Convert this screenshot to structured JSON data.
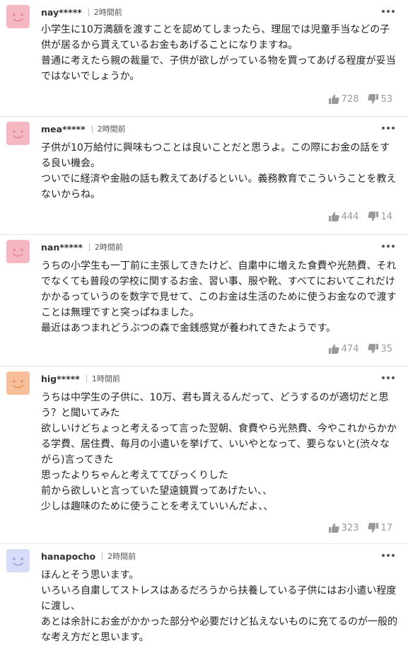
{
  "comments": [
    {
      "username": "nay*****",
      "time": "2時間前",
      "avatar_color": "#f5b7c2",
      "avatar_face_color": "#e48a9a",
      "text": "小学生に10万満額を渡すことを認めてしまったら、理屈では児童手当などの子供が居るから貰えているお金もあげることになりますね。\n普通に考えたら親の裁量で、子供が欲しがっている物を買ってあげる程度が妥当ではないでしょうか。",
      "likes": "728",
      "dislikes": "53"
    },
    {
      "username": "mea*****",
      "time": "2時間前",
      "avatar_color": "#f5b7c2",
      "avatar_face_color": "#e48a9a",
      "text": "子供が10万給付に興味もつことは良いことだと思うよ。この際にお金の話をする良い機会。\nついでに経済や金融の話も教えてあげるといい。義務教育でこういうことを教えないからね。",
      "likes": "444",
      "dislikes": "14"
    },
    {
      "username": "nan*****",
      "time": "2時間前",
      "avatar_color": "#f5b7c2",
      "avatar_face_color": "#e48a9a",
      "text": "うちの小学生も一丁前に主張してきたけど、自粛中に増えた食費や光熱費、それでなくても普段の学校に関するお金、習い事、服や靴、すべてにおいてこれだけかかるっていうのを数字で見せて、このお金は生活のために使うお金なので渡すことは無理ですと突っぱねました。\n最近はあつまれどうぶつの森で金銭感覚が養われてきたようです。",
      "likes": "474",
      "dislikes": "35"
    },
    {
      "username": "hig*****",
      "time": "1時間前",
      "avatar_color": "#f8c09a",
      "avatar_face_color": "#e0925c",
      "text": "うちは中学生の子供に、10万、君も貰えるんだって、どうするのが適切だと思う？と聞いてみた\n欲しいけどちょっと考えるって言った翌朝、食費やら光熱費、今やこれからかかる学費、居住費、毎月の小遣いを挙げて、いいやとなって、要らないと(渋々ながら)言ってきた\n思ったよりちゃんと考えててびっくりした\n前から欲しいと言っていた望遠鏡買ってあげたい、、\n少しは趣味のために使うことを考えていいんだよ、、",
      "likes": "323",
      "dislikes": "17"
    },
    {
      "username": "hanapocho",
      "time": "2時間前",
      "avatar_color": "#d6dcf7",
      "avatar_face_color": "#9aa6e0",
      "text": "ほんとそう思います。\nいろいろ自粛してストレスはあるだろうから扶養している子供にはお小遣い程度に渡し、\nあとは余計にお金がかかった部分や必要だけど払えないものに充てるのが一般的な考え方だと思います。",
      "likes": "",
      "dislikes": ""
    }
  ],
  "icons": {
    "more": "more-dots-icon",
    "like": "thumbs-up-icon",
    "dislike": "thumbs-down-icon",
    "avatar": "smiley-avatar-icon"
  },
  "colors": {
    "divider": "#e6e6e6",
    "reaction": "#9a9a9a",
    "text": "#222222"
  }
}
